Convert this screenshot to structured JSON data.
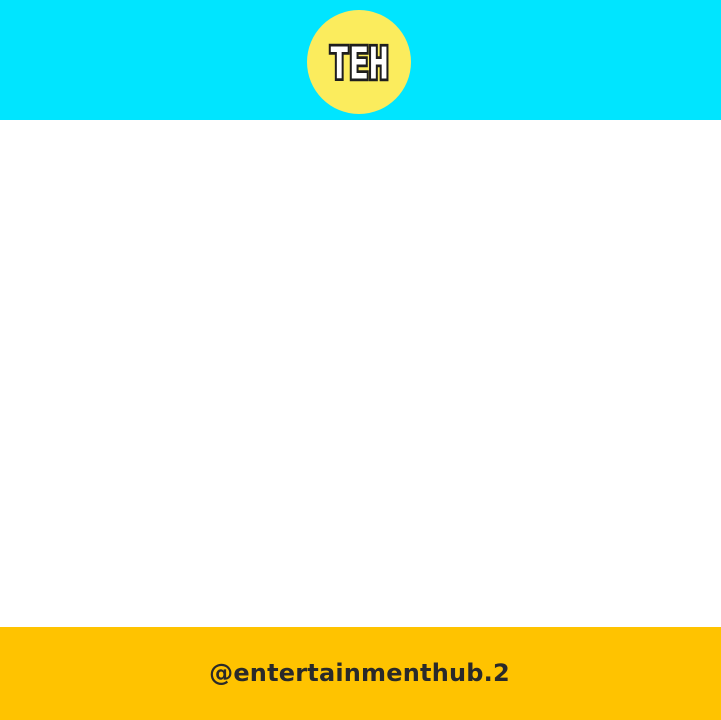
{
  "colors": {
    "header_background": "#00e5ff",
    "logo_badge": "#fbec5d",
    "content_background": "#ffffff",
    "footer_background": "#ffc300",
    "footer_text": "#2a2a2a"
  },
  "header": {
    "logo_text": "TEH"
  },
  "footer": {
    "handle": "@entertainmenthub.2"
  }
}
